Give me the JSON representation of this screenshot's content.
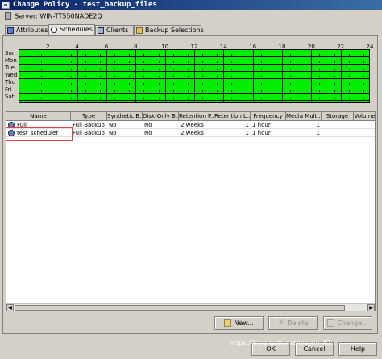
{
  "window": {
    "title": "Change Policy - test_backup_files"
  },
  "server": {
    "label": "Server: WIN-TT550NADE2Q"
  },
  "tabs": [
    {
      "label": "Attributes",
      "active": false
    },
    {
      "label": "Schedules",
      "active": true
    },
    {
      "label": "Clients",
      "active": false
    },
    {
      "label": "Backup Selections",
      "active": false
    }
  ],
  "schedule_grid": {
    "hours": [
      "2",
      "4",
      "6",
      "8",
      "10",
      "12",
      "14",
      "16",
      "18",
      "20",
      "22",
      "24"
    ],
    "days": [
      "Sun",
      "Mon",
      "Tue",
      "Wed",
      "Thu",
      "Fri",
      "Sat"
    ],
    "fill_color": "#00ee00"
  },
  "table": {
    "columns": [
      "Name",
      "Type",
      "Synthetic B...",
      "Disk-Only B...",
      "Retention P...",
      "Retention L...",
      "Frequency",
      "Media Multi...",
      "Storage",
      "Volume"
    ],
    "rows": [
      [
        "Full",
        "Full Backup",
        "No",
        "No",
        "2 weeks",
        "1",
        "1 hour",
        "1",
        "",
        ""
      ],
      [
        "test_scheduler",
        "Full Backup",
        "No",
        "No",
        "2 weeks",
        "1",
        "1 hour",
        "1",
        "",
        ""
      ]
    ]
  },
  "buttons": {
    "new": "New...",
    "delete": "Delete",
    "change": "Change...",
    "ok": "OK",
    "cancel": "Cancel",
    "help": "Help"
  },
  "colors": {
    "title_bar": "#0a246a",
    "highlight": "#e04040"
  },
  "watermark": "https://blog.csdn.net/weixin_42..."
}
